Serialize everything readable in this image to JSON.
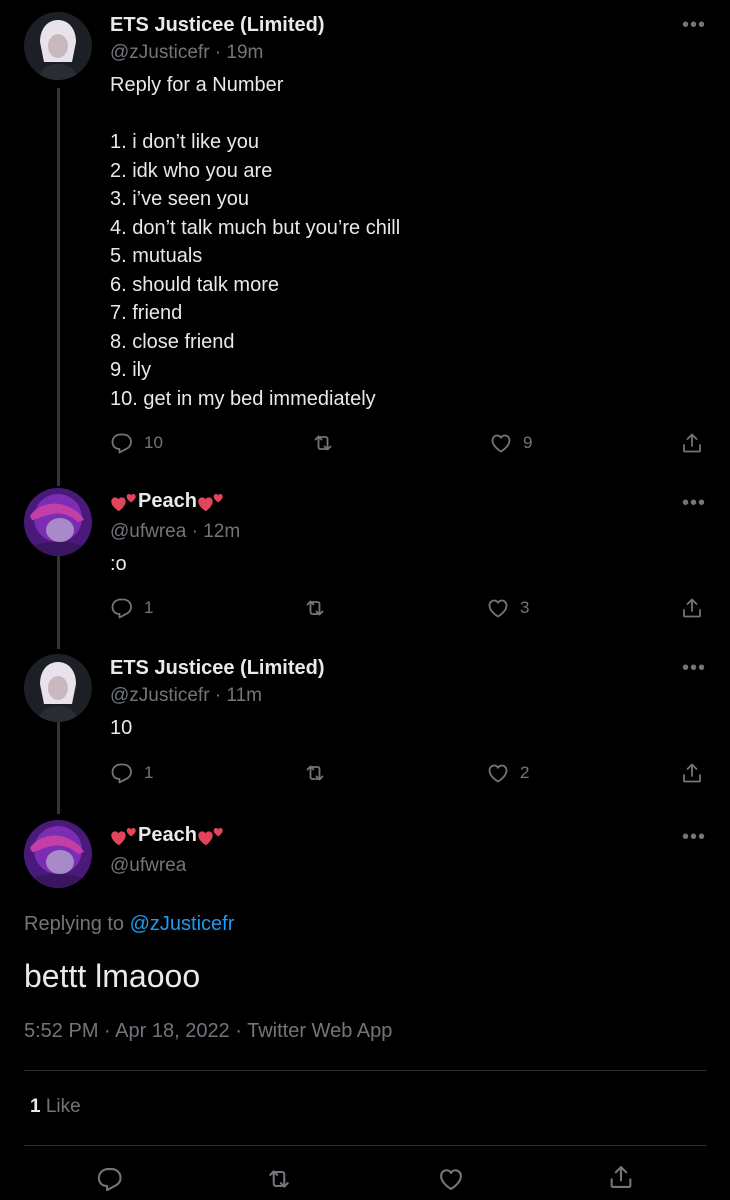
{
  "tweets": [
    {
      "name": "ETS Justicee (Limited)",
      "handle": "@zJusticefr",
      "time": "19m",
      "text": "Reply for a Number\n\n1. i don’t like you\n2. idk who you are\n3. i’ve seen you\n4. don’t talk much but you’re chill\n5. mutuals\n6. should talk more\n7. friend\n8. close friend\n9. ily\n10. get in my bed immediately",
      "replies": "10",
      "likes": "9"
    },
    {
      "name": "Peach",
      "handle": "@ufwrea",
      "time": "12m",
      "text": ":o",
      "replies": "1",
      "likes": "3"
    },
    {
      "name": "ETS Justicee (Limited)",
      "handle": "@zJusticefr",
      "time": "11m",
      "text": "10",
      "replies": "1",
      "likes": "2"
    }
  ],
  "main_tweet": {
    "name": "Peach",
    "handle": "@ufwrea",
    "replying_label": "Replying to",
    "replying_to": "@zJusticefr",
    "text": "bettt lmaooo",
    "meta": "5:52 PM · Apr 18, 2022 · Twitter Web App",
    "like_count": "1",
    "like_label": "Like"
  },
  "separator": "·",
  "more_label": "•••",
  "colors": {
    "background": "#000000",
    "text": "#e7e9ea",
    "secondary": "#71767b",
    "link": "#1d9bf0",
    "divider": "#2f3336"
  },
  "icons": [
    "reply-icon",
    "retweet-icon",
    "like-icon",
    "share-icon",
    "more-icon",
    "two-hearts-emoji"
  ]
}
